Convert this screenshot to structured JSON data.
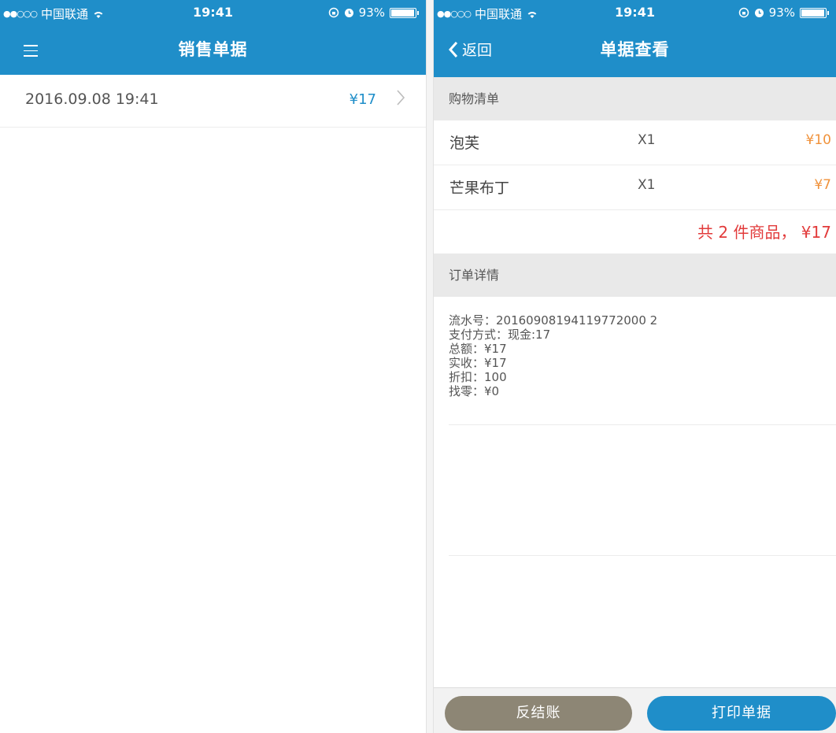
{
  "left": {
    "status": {
      "carrier": "中国联通",
      "time": "19:41",
      "battery": "93%"
    },
    "title": "销售单据",
    "bills": [
      {
        "date": "2016.09.08 19:41",
        "amount": "¥17"
      }
    ]
  },
  "right": {
    "status": {
      "carrier": "中国联通",
      "time": "19:41",
      "battery": "93%"
    },
    "back_label": "返回",
    "title": "单据查看",
    "shopping_section": "购物清单",
    "items": [
      {
        "name": "泡芙",
        "qty": "X1",
        "price": "¥10"
      },
      {
        "name": "芒果布丁",
        "qty": "X1",
        "price": "¥7"
      }
    ],
    "summary": "共 2 件商品， ¥17",
    "order_section": "订单详情",
    "details": [
      "流水号：20160908194119772000 2",
      "支付方式：现金:17",
      "总额：¥17",
      "实收：¥17",
      "折扣：100",
      "找零：¥0"
    ],
    "buttons": {
      "unsettle": "反结账",
      "print": "打印单据"
    }
  },
  "colors": {
    "accent": "#1f8ec9",
    "price": "#f0923b",
    "total": "#e23b3b",
    "secondary_button": "#8d8675"
  }
}
